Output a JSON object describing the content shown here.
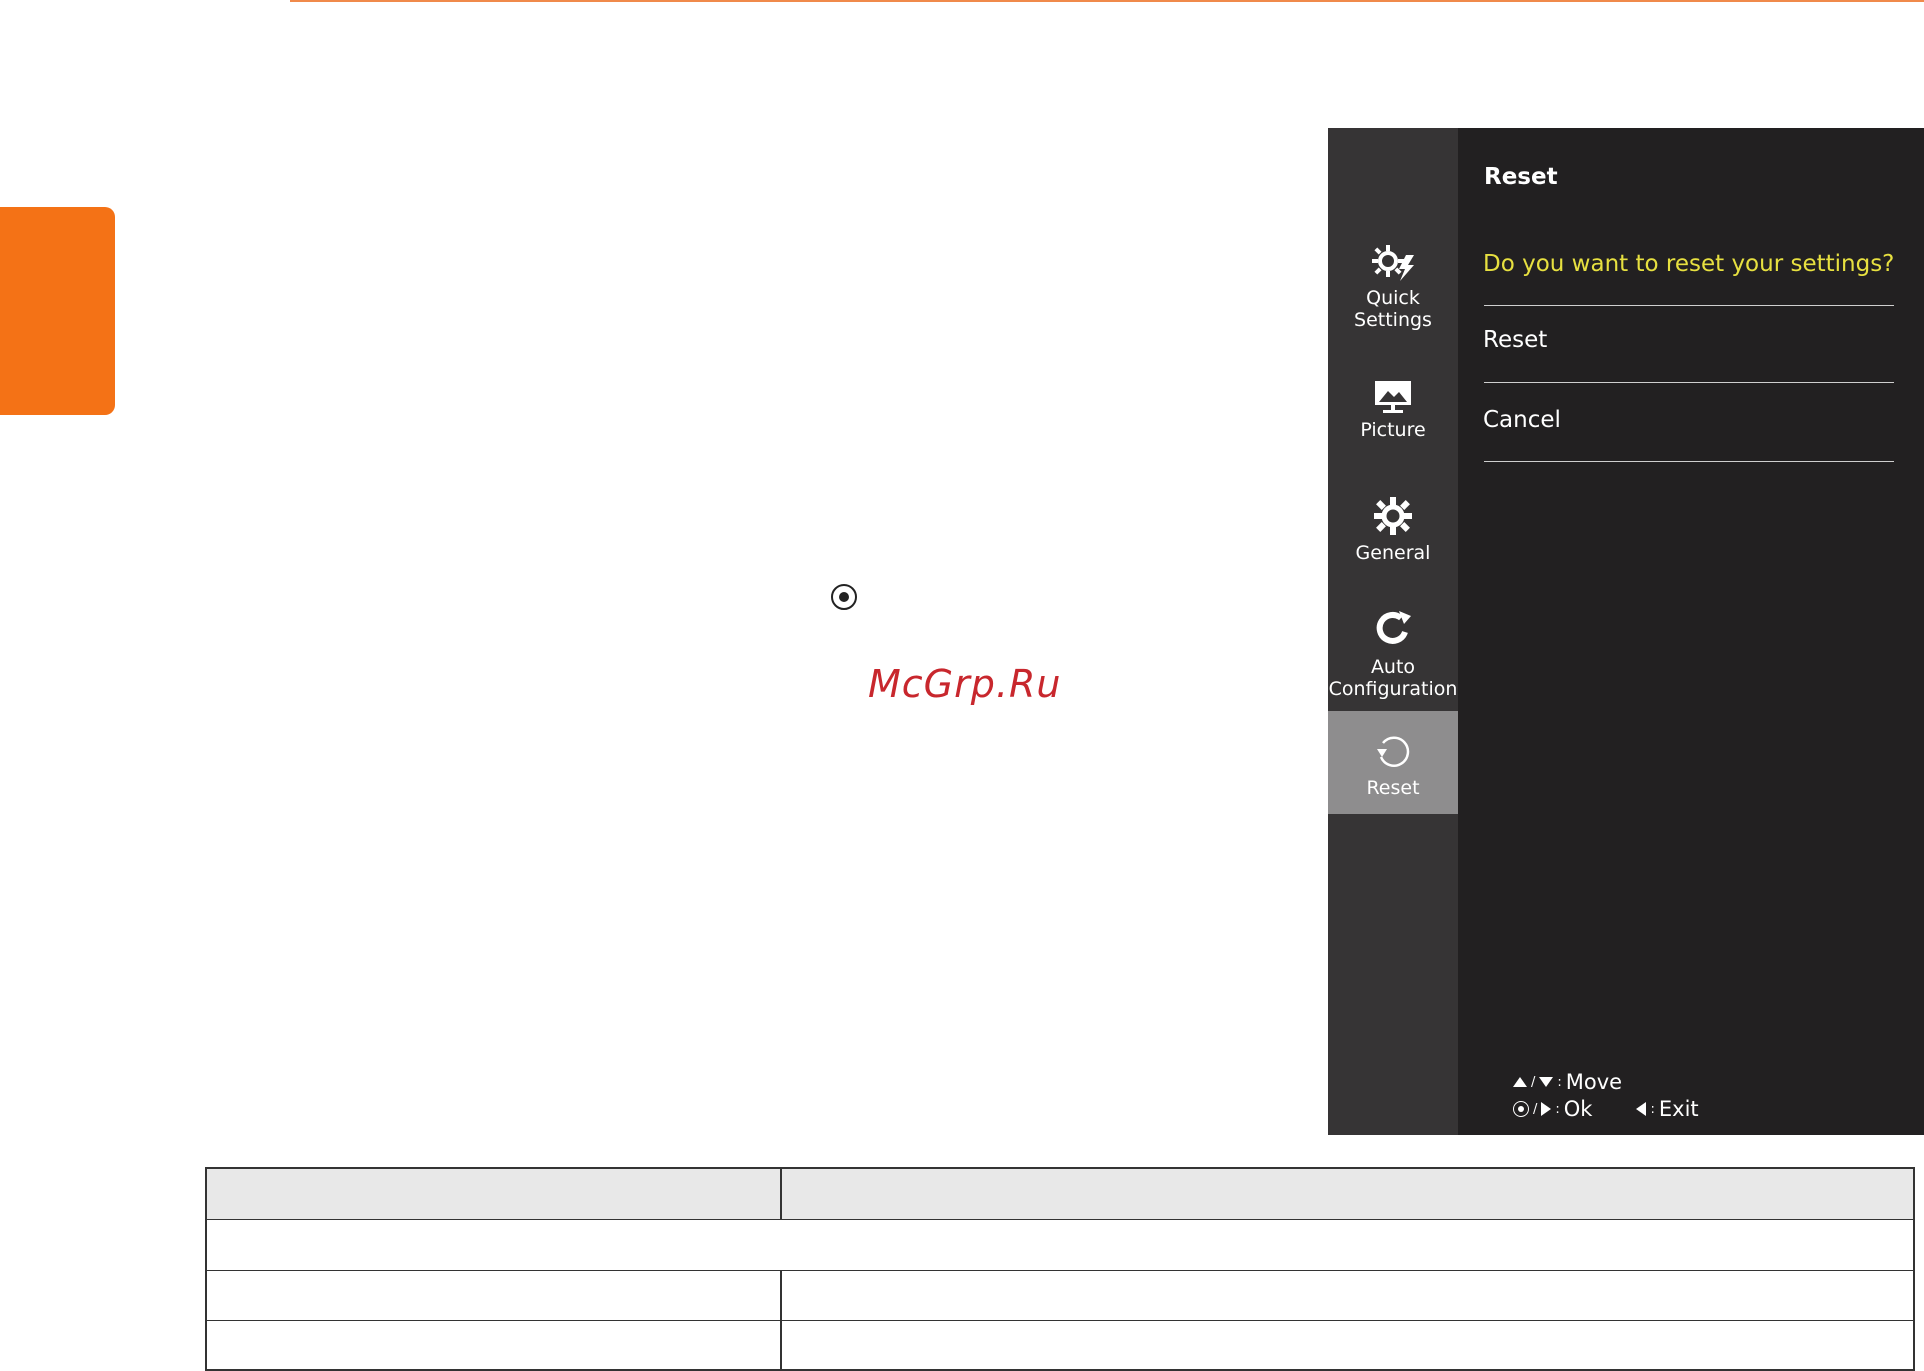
{
  "watermark": "McGrp.Ru",
  "osd": {
    "nav_items": [
      {
        "label_line1": "Quick",
        "label_line2": "Settings",
        "icon": "quick-settings-icon",
        "active": false
      },
      {
        "label_line1": "Picture",
        "label_line2": "",
        "icon": "picture-icon",
        "active": false
      },
      {
        "label_line1": "General",
        "label_line2": "",
        "icon": "gear-icon",
        "active": false
      },
      {
        "label_line1": "Auto",
        "label_line2": "Configuration",
        "icon": "auto-configuration-icon",
        "active": false
      },
      {
        "label_line1": "Reset",
        "label_line2": "",
        "icon": "reset-icon",
        "active": true
      }
    ],
    "panel": {
      "title": "Reset",
      "question": "Do you want to reset your settings?",
      "options": [
        "Reset",
        "Cancel"
      ]
    },
    "hints": {
      "slash": "/",
      "colon": ":",
      "move": "Move",
      "ok": "Ok",
      "exit": "Exit"
    }
  },
  "colors": {
    "accent_orange": "#f47216",
    "osd_background": "#222021",
    "osd_nav_background": "#363435",
    "osd_nav_active": "#8e8d8e",
    "question_text": "#e7e040",
    "watermark": "#c8272d",
    "table_header_fill": "#e8e8e8"
  }
}
